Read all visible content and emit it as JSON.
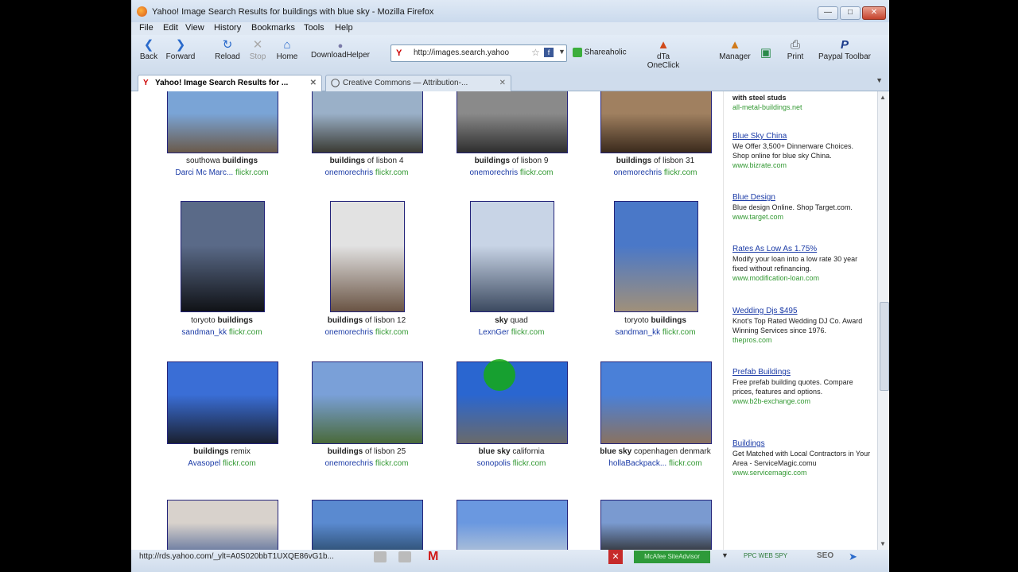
{
  "window": {
    "title": "Yahoo! Image Search Results for buildings with blue sky - Mozilla Firefox",
    "controls": [
      "—",
      "□",
      "✕"
    ]
  },
  "menu": [
    "File",
    "Edit",
    "View",
    "History",
    "Bookmarks",
    "Tools",
    "Help"
  ],
  "toolbar": {
    "back": "Back",
    "forward": "Forward",
    "reload": "Reload",
    "stop": "Stop",
    "home": "Home",
    "downloadhelper": "DownloadHelper",
    "url": "http://images.search.yahoo",
    "shareaholic": "Shareaholic",
    "dta": "dTa OneClick",
    "manager": "Manager",
    "print": "Print",
    "paypal": "Paypal Toolbar"
  },
  "tabs": [
    {
      "label": "Yahoo! Image Search Results for ..."
    },
    {
      "label": "Creative Commons — Attribution-..."
    }
  ],
  "results": [
    {
      "caption_pre": "southowa ",
      "caption_bold": "buildings",
      "caption_post": "",
      "by": "Darci Mc Marc...",
      "domain": "flickr.com",
      "colors": [
        "#7aa4d6",
        "#6a5a4a"
      ]
    },
    {
      "caption_pre": "",
      "caption_bold": "buildings",
      "caption_post": " of lisbon 4",
      "by": "onemorechris",
      "domain": "flickr.com",
      "colors": [
        "#9ab0c8",
        "#3a3a32"
      ]
    },
    {
      "caption_pre": "",
      "caption_bold": "buildings",
      "caption_post": " of lisbon 9",
      "by": "onemorechris",
      "domain": "flickr.com",
      "colors": [
        "#8a8a8a",
        "#2e2e2e"
      ]
    },
    {
      "caption_pre": "",
      "caption_bold": "buildings",
      "caption_post": " of lisbon 31",
      "by": "onemorechris",
      "domain": "flickr.com",
      "colors": [
        "#a08060",
        "#3a2a1c"
      ]
    },
    {
      "caption_pre": "toryoto ",
      "caption_bold": "buildings",
      "caption_post": "",
      "by": "sandman_kk",
      "domain": "flickr.com",
      "colors": [
        "#5a6a88",
        "#101216"
      ]
    },
    {
      "caption_pre": "",
      "caption_bold": "buildings",
      "caption_post": " of lisbon 12",
      "by": "onemorechris",
      "domain": "flickr.com",
      "colors": [
        "#e2e2e2",
        "#6a5444"
      ]
    },
    {
      "caption_pre": "",
      "caption_bold": "sky",
      "caption_post": " quad",
      "by": "LexnGer",
      "domain": "flickr.com",
      "colors": [
        "#c8d4e6",
        "#3c4a60"
      ]
    },
    {
      "caption_pre": "toryoto ",
      "caption_bold": "buildings",
      "caption_post": "",
      "by": "sandman_kk",
      "domain": "flickr.com",
      "colors": [
        "#4a78c8",
        "#a0907a"
      ]
    },
    {
      "caption_pre": "",
      "caption_bold": "buildings",
      "caption_post": " remix",
      "by": "Avasopel",
      "domain": "flickr.com",
      "colors": [
        "#3a6ed6",
        "#1a2030"
      ]
    },
    {
      "caption_pre": "",
      "caption_bold": "buildings",
      "caption_post": " of lisbon 25",
      "by": "onemorechris",
      "domain": "flickr.com",
      "colors": [
        "#7aa0d8",
        "#4a6a3a"
      ]
    },
    {
      "caption_pre": "",
      "caption_bold": "blue sky",
      "caption_post": " california",
      "by": "sonopolis",
      "domain": "flickr.com",
      "colors": [
        "#2a66d0",
        "#6a6a6a"
      ]
    },
    {
      "caption_pre": "",
      "caption_bold": "blue sky",
      "caption_post": " copenhagen denmark",
      "by": "hollaBackpack...",
      "domain": "flickr.com",
      "colors": [
        "#4a80d8",
        "#8a7260"
      ]
    },
    {
      "caption_pre": "",
      "caption_bold": "",
      "caption_post": "",
      "by": "",
      "domain": "",
      "colors": [
        "#d8d2cc",
        "#5a6e9a"
      ]
    },
    {
      "caption_pre": "",
      "caption_bold": "",
      "caption_post": "",
      "by": "",
      "domain": "",
      "colors": [
        "#5a8ad0",
        "#2a4a6a"
      ]
    },
    {
      "caption_pre": "",
      "caption_bold": "",
      "caption_post": "",
      "by": "",
      "domain": "",
      "colors": [
        "#6a98e0",
        "#b4c4d8"
      ]
    },
    {
      "caption_pre": "",
      "caption_bold": "",
      "caption_post": "",
      "by": "",
      "domain": "",
      "colors": [
        "#7a9ad0",
        "#2a2a2a"
      ]
    }
  ],
  "ads": [
    {
      "title": "",
      "body": "with steel studs",
      "url": "all-metal-buildings.net"
    },
    {
      "title": "Blue Sky China",
      "body": "We Offer 3,500+ Dinnerware Choices. Shop online for blue sky China.",
      "url": "www.bizrate.com"
    },
    {
      "title": "Blue Design",
      "body": "Blue design Online. Shop Target.com.",
      "url": "www.target.com"
    },
    {
      "title": "Rates As Low As 1.75%",
      "body": "Modify your loan into a low rate 30 year fixed without refinancing.",
      "url": "www.modification-loan.com"
    },
    {
      "title": "Wedding Djs $495",
      "body": "Knot's Top Rated Wedding DJ Co. Award Winning Services since 1976.",
      "url": "thepros.com"
    },
    {
      "title": "Prefab Buildings",
      "body": "Free prefab building quotes. Compare prices, features and options.",
      "url": "www.b2b-exchange.com"
    },
    {
      "title": "Buildings",
      "body": "Get Matched with Local Contractors in Your Area - ServiceMagic.comu",
      "url": "www.servicemagic.com"
    }
  ],
  "statusbar": {
    "text": "http://rds.yahoo.com/_ylt=A0S020bbT1UXQE86vG1b...",
    "mcafee": "McAfee SiteAdvisor",
    "ppc": "PPC WEB SPY",
    "seo": "SEO"
  },
  "colors": {
    "link": "#1a3aa6",
    "url_green": "#339933",
    "cursor": "#14aa14"
  }
}
